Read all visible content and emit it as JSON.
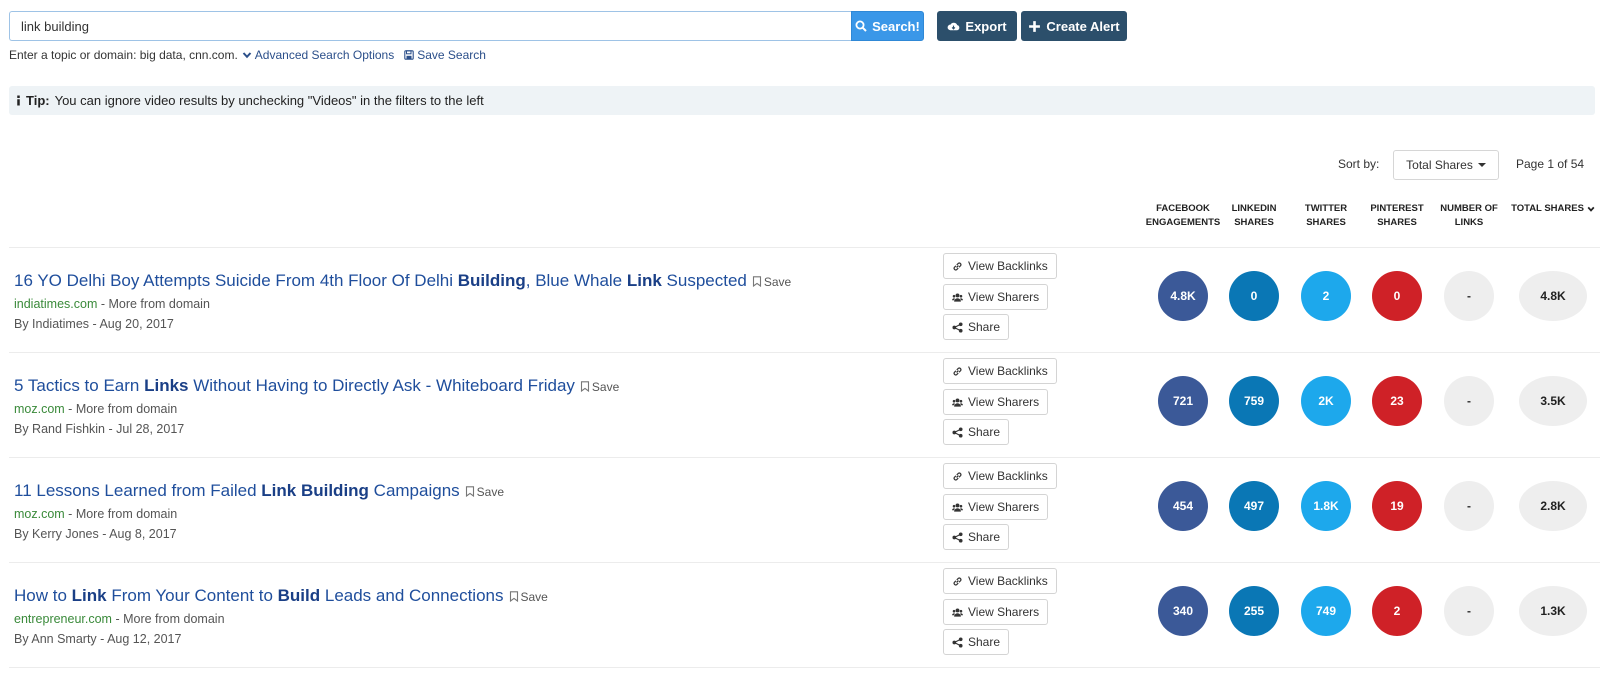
{
  "search": {
    "value": "link building",
    "button_label": "Search!",
    "helper_text": "Enter a topic or domain: big data, cnn.com.",
    "advanced_label": "Advanced Search Options",
    "save_search_label": "Save Search"
  },
  "toolbar": {
    "export_label": "Export",
    "create_alert_label": "Create Alert"
  },
  "tip": {
    "prefix": "Tip:",
    "text": "You can ignore video results by unchecking \"Videos\" in the filters to the left"
  },
  "sort": {
    "label": "Sort by:",
    "selected": "Total Shares",
    "page_info": "Page 1 of 54"
  },
  "columns": [
    "FACEBOOK\nENGAGEMENTS",
    "LINKEDIN\nSHARES",
    "TWITTER\nSHARES",
    "PINTEREST\nSHARES",
    "NUMBER OF\nLINKS",
    "TOTAL SHARES"
  ],
  "actions": {
    "view_backlinks": "View Backlinks",
    "view_sharers": "View Sharers",
    "share": "Share",
    "save": "Save",
    "more_from_domain": "More from domain"
  },
  "results": [
    {
      "title_parts": [
        {
          "t": "16 YO Delhi Boy Attempts Suicide From 4th Floor Of Delhi ",
          "b": false
        },
        {
          "t": "Building",
          "b": true
        },
        {
          "t": ", Blue Whale ",
          "b": false
        },
        {
          "t": "Link",
          "b": true
        },
        {
          "t": " Suspected",
          "b": false
        }
      ],
      "domain": "indiatimes.com",
      "author_date": "By Indiatimes - Aug 20, 2017",
      "metrics": {
        "facebook": "4.8K",
        "linkedin": "0",
        "twitter": "2",
        "pinterest": "0",
        "links": "-",
        "total": "4.8K"
      }
    },
    {
      "title_parts": [
        {
          "t": "5 Tactics to Earn ",
          "b": false
        },
        {
          "t": "Links",
          "b": true
        },
        {
          "t": " Without Having to Directly Ask - Whiteboard Friday",
          "b": false
        }
      ],
      "domain": "moz.com",
      "author_date": "By Rand Fishkin - Jul 28, 2017",
      "metrics": {
        "facebook": "721",
        "linkedin": "759",
        "twitter": "2K",
        "pinterest": "23",
        "links": "-",
        "total": "3.5K"
      }
    },
    {
      "title_parts": [
        {
          "t": "11 Lessons Learned from Failed ",
          "b": false
        },
        {
          "t": "Link Building",
          "b": true
        },
        {
          "t": " Campaigns",
          "b": false
        }
      ],
      "domain": "moz.com",
      "author_date": "By Kerry Jones - Aug 8, 2017",
      "metrics": {
        "facebook": "454",
        "linkedin": "497",
        "twitter": "1.8K",
        "pinterest": "19",
        "links": "-",
        "total": "2.8K"
      }
    },
    {
      "title_parts": [
        {
          "t": "How to ",
          "b": false
        },
        {
          "t": "Link",
          "b": true
        },
        {
          "t": " From Your Content to ",
          "b": false
        },
        {
          "t": "Build",
          "b": true
        },
        {
          "t": " Leads and Connections",
          "b": false
        }
      ],
      "domain": "entrepreneur.com",
      "author_date": "By Ann Smarty - Aug 12, 2017",
      "metrics": {
        "facebook": "340",
        "linkedin": "255",
        "twitter": "749",
        "pinterest": "2",
        "links": "-",
        "total": "1.3K"
      }
    }
  ]
}
